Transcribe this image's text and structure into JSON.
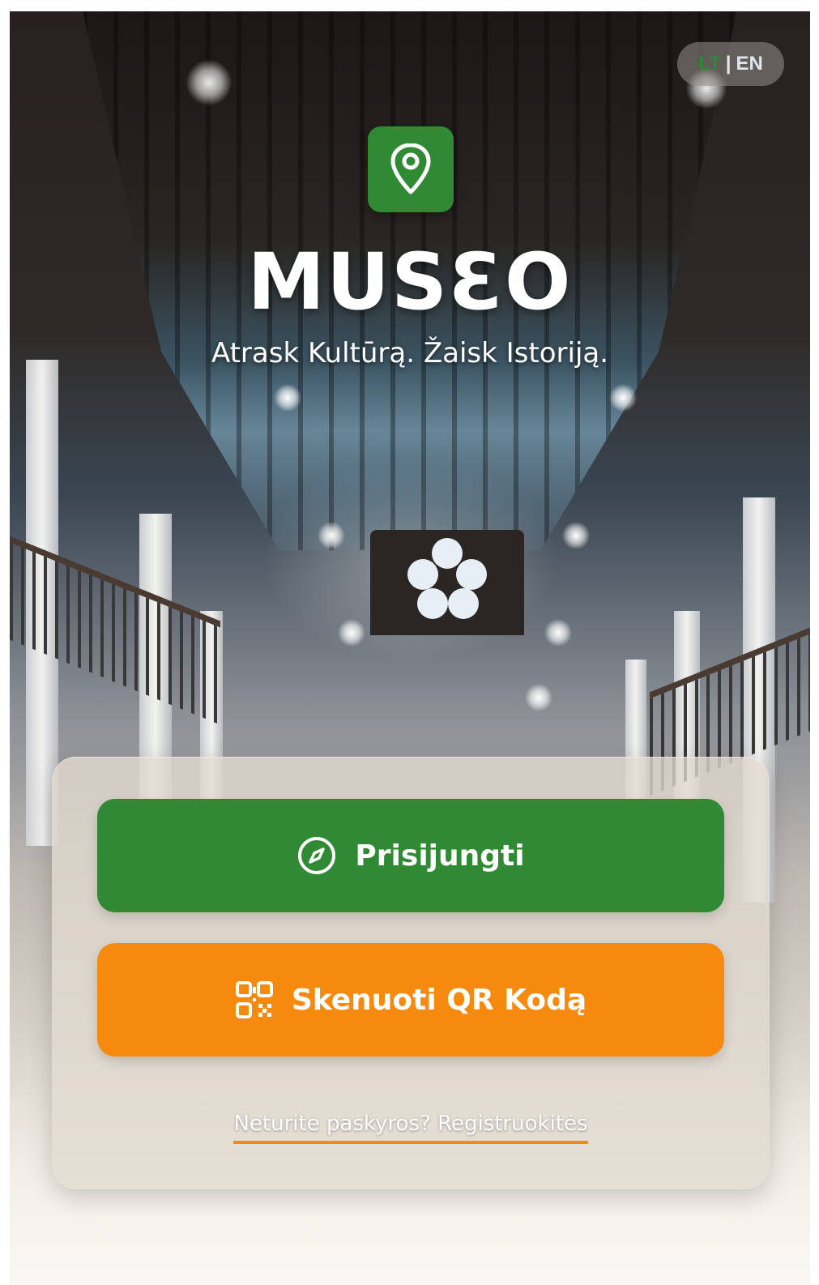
{
  "language_switch": {
    "active": "LT",
    "separator": "|",
    "inactive": "EN",
    "active_color": "#2e8b34"
  },
  "logo": {
    "icon": "map-pin-icon",
    "badge_color": "#2f8a33"
  },
  "brand": {
    "name": "MUSƐO",
    "tagline": "Atrask Kultūrą. Žaisk Istoriją."
  },
  "actions": {
    "login_label": "Prisijungti",
    "login_icon": "compass-icon",
    "login_color": "#2f8a33",
    "scan_label": "Skenuoti QR Kodą",
    "scan_icon": "qr-code-icon",
    "scan_color": "#f68a0e"
  },
  "register_link": "Neturite paskyros? Registruokitės"
}
